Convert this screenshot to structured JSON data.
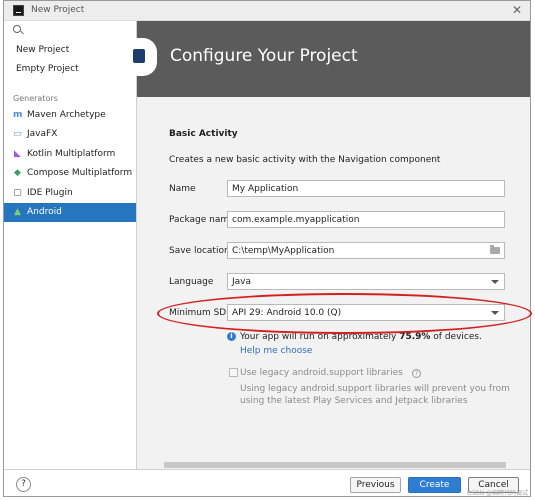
{
  "window": {
    "title": "New Project",
    "close_glyph": "✕",
    "app_icon": "intellij-app-icon"
  },
  "sidebar": {
    "search_icon": "search-icon",
    "top_items": [
      "New Project",
      "Empty Project"
    ],
    "generators_heading": "Generators",
    "generators": [
      {
        "label": "Maven Archetype",
        "icon": "maven-icon",
        "glyph": "m",
        "color": "#4a8bd6"
      },
      {
        "label": "JavaFX",
        "icon": "javafx-icon",
        "glyph": "▭",
        "color": "#6a8fb3"
      },
      {
        "label": "Kotlin Multiplatform",
        "icon": "kotlin-icon",
        "glyph": "◣",
        "color": "#9b5de5"
      },
      {
        "label": "Compose Multiplatform",
        "icon": "compose-icon",
        "glyph": "◆",
        "color": "#3c9a6e"
      },
      {
        "label": "IDE Plugin",
        "icon": "plugin-icon",
        "glyph": "▢",
        "color": "#555555"
      },
      {
        "label": "Android",
        "icon": "android-icon",
        "glyph": "▲",
        "color": "#7fd36b",
        "selected": true
      }
    ]
  },
  "banner": {
    "title": "Configure Your Project",
    "logo": "android-studio-logo"
  },
  "form": {
    "section_title": "Basic Activity",
    "description": "Creates a new basic activity with the Navigation component",
    "name_label": "Name",
    "name_value": "My Application",
    "package_label": "Package name",
    "package_value": "com.example.myapplication",
    "save_label": "Save location",
    "save_value": "C:\\temp\\MyApplication",
    "language_label": "Language",
    "language_value": "Java",
    "minsdk_label": "Minimum SDK",
    "minsdk_value": "API 29: Android 10.0 (Q)",
    "info_prefix": "Your app will run on approximately ",
    "info_percent": "75.9%",
    "info_suffix": " of devices.",
    "help_link": "Help me choose",
    "legacy_label": "Use legacy android.support libraries",
    "legacy_checked": false,
    "legacy_desc": "Using legacy android.support libraries will prevent you from using the latest Play Services and Jetpack libraries"
  },
  "footer": {
    "help_glyph": "?",
    "previous": "Previous",
    "create": "Create",
    "cancel": "Cancel",
    "watermark": "CSDN @招聘代码调试"
  },
  "colors": {
    "accent": "#2e7dd2",
    "selection": "#2675bf",
    "banner": "#5b5b5b",
    "annotation": "#d42020"
  }
}
